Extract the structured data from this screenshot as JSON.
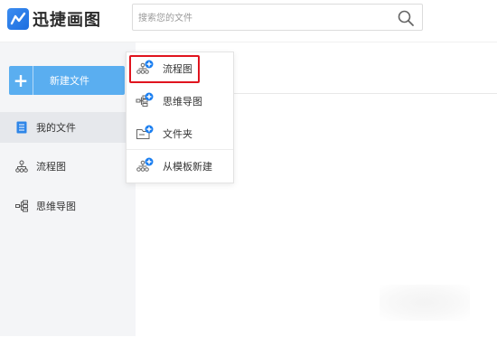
{
  "app": {
    "title": "迅捷画图"
  },
  "search": {
    "placeholder": "搜索您的文件"
  },
  "sidebar": {
    "new_file_label": "新建文件",
    "items": [
      {
        "label": "我的文件",
        "active": true,
        "icon": "document-icon"
      },
      {
        "label": "流程图",
        "active": false,
        "icon": "flowchart-icon"
      },
      {
        "label": "思维导图",
        "active": false,
        "icon": "mindmap-icon"
      }
    ]
  },
  "new_menu": {
    "items": [
      {
        "label": "流程图",
        "icon": "flowchart-add-icon",
        "highlighted": true
      },
      {
        "label": "思维导图",
        "icon": "mindmap-add-icon",
        "highlighted": false
      },
      {
        "label": "文件夹",
        "icon": "folder-add-icon",
        "highlighted": false
      },
      {
        "label": "从模板新建",
        "icon": "template-add-icon",
        "highlighted": false
      }
    ]
  },
  "colors": {
    "accent": "#5aaef0",
    "badge": "#1a7ef0",
    "highlight_border": "#e0141e",
    "sidebar_bg": "#f4f5f7"
  }
}
